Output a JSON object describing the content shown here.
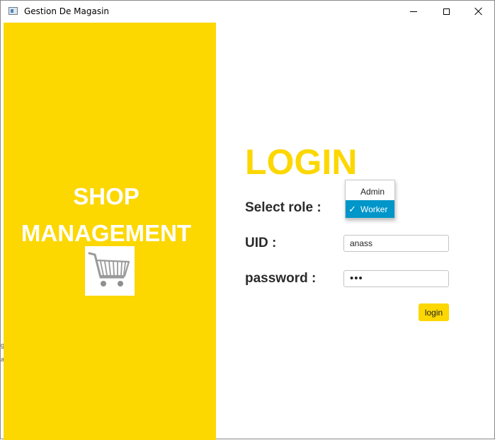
{
  "window": {
    "title": "Gestion De Magasin",
    "controls": {
      "minimize_icon": "minimize-icon",
      "maximize_icon": "maximize-icon",
      "close_icon": "close-icon"
    }
  },
  "colors": {
    "accent_yellow": "#fcd700",
    "selection_blue": "#0096c9",
    "label_text": "#2b2b2b"
  },
  "brand": {
    "line1": "SHOP",
    "line2": "MANAGEMENT",
    "logo_icon": "shopping-cart-icon"
  },
  "login": {
    "heading": "LOGIN",
    "role_label": "Select role :",
    "uid_label": "UID :",
    "uid_value": "anass",
    "password_label": "password :",
    "password_value": "•••",
    "button_label": "login"
  },
  "role_dropdown": {
    "options": [
      "Admin",
      "Worker"
    ],
    "selected": "Worker",
    "check_glyph": "✓"
  },
  "background_edge": {
    "glyph1": "g",
    "glyph2": "a"
  }
}
